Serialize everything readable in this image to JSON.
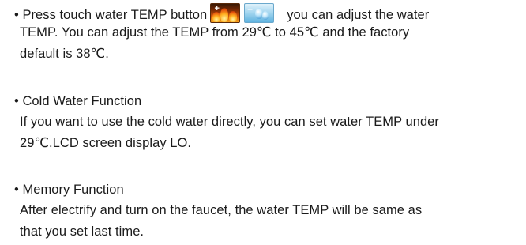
{
  "paragraphs": {
    "temp_adjust": {
      "line1_before": "• Press touch water TEMP button",
      "line1_after": "you can adjust the water",
      "line2": "TEMP. You can adjust the TEMP from  29℃  to  45℃   and the factory",
      "line3": "default  is 38℃.",
      "icons": {
        "hot": "hot-water-temp-up-icon",
        "cold": "cold-water-temp-down-icon"
      }
    },
    "cold_water": {
      "heading": "• Cold Water Function",
      "line1": "If you want to use the cold water directly, you can set water TEMP under",
      "line2": "29℃.LCD screen display LO."
    },
    "memory": {
      "heading": "• Memory Function",
      "line1": "After electrify and turn on the faucet, the water TEMP will be same as",
      "line2": "that  you set last time."
    }
  }
}
